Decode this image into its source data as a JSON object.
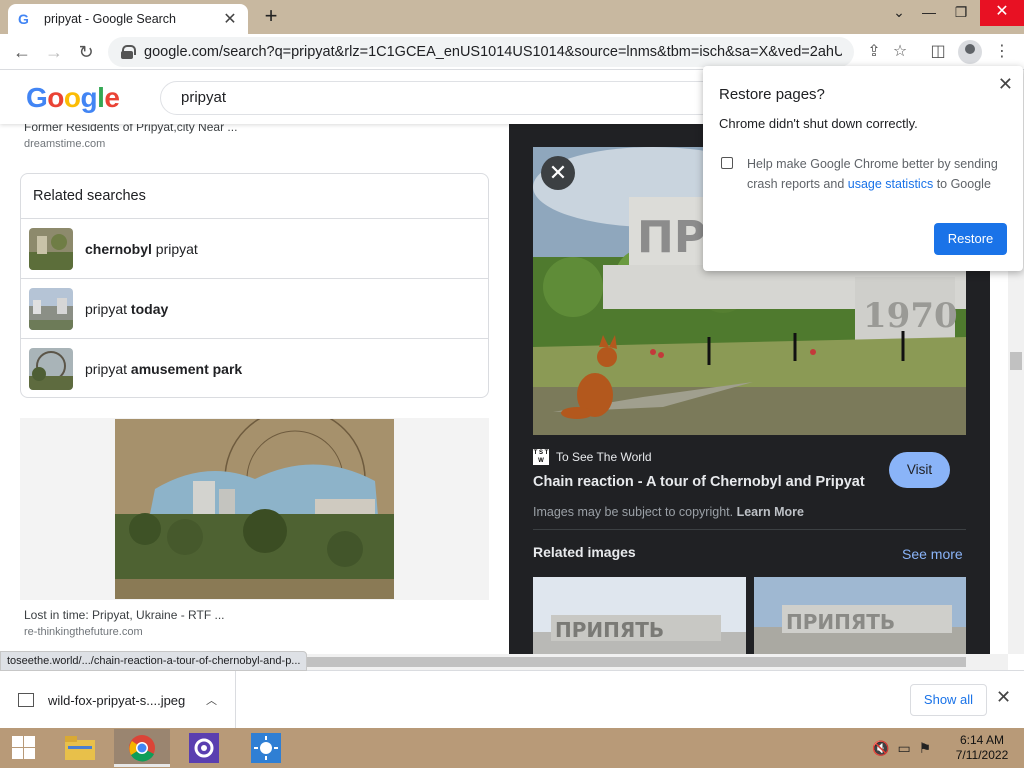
{
  "browser": {
    "tab_title": "pripyat - Google Search",
    "tab_favicon": "G",
    "new_tab_label": "+",
    "url": "google.com/search?q=pripyat&rlz=1C1GCEA_enUS1014US1014&source=lnms&tbm=isch&sa=X&ved=2ahUKE...",
    "status_url": "toseethe.world/.../chain-reaction-a-tour-of-chernobyl-and-p..."
  },
  "google": {
    "logo_letters": [
      "G",
      "o",
      "o",
      "g",
      "l",
      "e"
    ],
    "logo_colors": [
      "#4285f4",
      "#ea4335",
      "#fbbc05",
      "#4285f4",
      "#34a853",
      "#ea4335"
    ],
    "query": "pripyat"
  },
  "results": {
    "top_caption": "Former Residents of Pripyat,city Near ...",
    "top_source": "dreamstime.com",
    "related_title": "Related searches",
    "related": [
      {
        "plain": "",
        "bold": "chernobyl",
        "suffix": " pripyat"
      },
      {
        "plain": "pripyat ",
        "bold": "today",
        "suffix": ""
      },
      {
        "plain": "pripyat ",
        "bold": "amusement park",
        "suffix": ""
      }
    ],
    "ruins_caption": "Lost in time: Pripyat, Ukraine - RTF ...",
    "ruins_source": "re-thinkingthefuture.com"
  },
  "preview": {
    "site_logo": "T S T W",
    "site_name": "To See The World",
    "title": "Chain reaction - A tour of Chernobyl and Pripyat",
    "visit_label": "Visit",
    "copyright_text": "Images may be subject to copyright.",
    "learn_more": "Learn More",
    "related_images_title": "Related images",
    "see_more": "See more",
    "sign_text": "ПРИПЯТЬ",
    "sign_year": "1970"
  },
  "restore_dialog": {
    "title": "Restore pages?",
    "message": "Chrome didn't shut down correctly.",
    "checkbox_pre": "Help make Google Chrome better by sending crash reports and ",
    "checkbox_link": "usage statistics",
    "checkbox_post": " to Google",
    "restore_label": "Restore"
  },
  "downloads": {
    "file_name": "wild-fox-pripyat-s....jpeg",
    "show_all_label": "Show all"
  },
  "taskbar": {
    "time": "6:14 AM",
    "date": "7/11/2022"
  }
}
